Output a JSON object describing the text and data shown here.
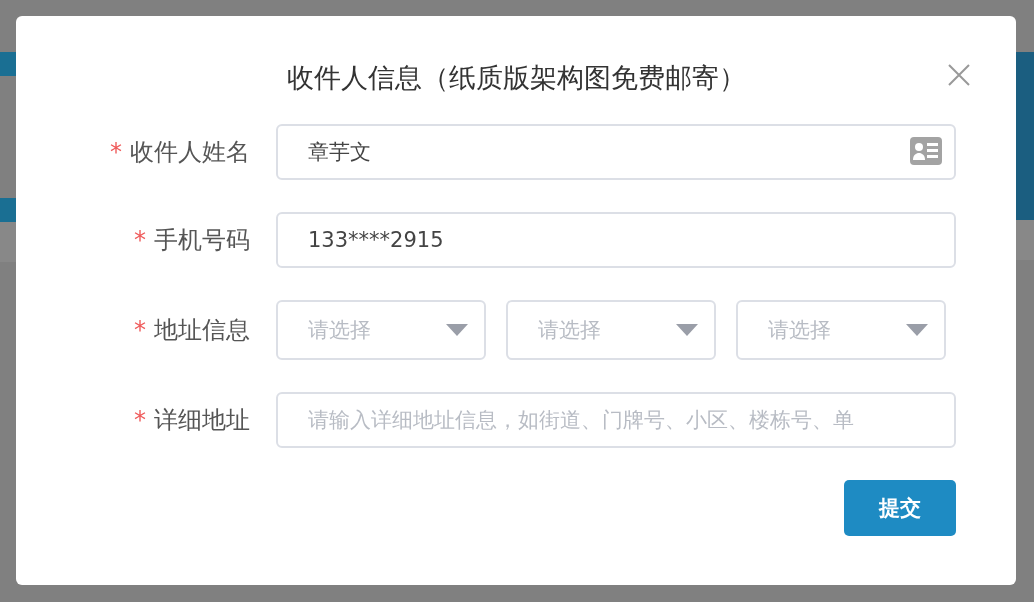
{
  "dialog": {
    "title": "收件人信息（纸质版架构图免费邮寄）",
    "fields": [
      {
        "kind": "card",
        "required_mark": "*",
        "label": "收件人姓名",
        "value": "章芋文"
      },
      {
        "kind": "text",
        "required_mark": "*",
        "label": "手机号码",
        "value": "133****2915"
      },
      {
        "kind": "select",
        "required_mark": "*",
        "label": "地址信息",
        "selects": [
          {
            "placeholder": "请选择"
          },
          {
            "placeholder": "请选择"
          },
          {
            "placeholder": "请选择"
          }
        ]
      },
      {
        "kind": "text",
        "required_mark": "*",
        "label": "详细地址",
        "placeholder": "请输入详细地址信息，如街道、门牌号、小区、楼栋号、单"
      }
    ],
    "submit": "提交"
  }
}
